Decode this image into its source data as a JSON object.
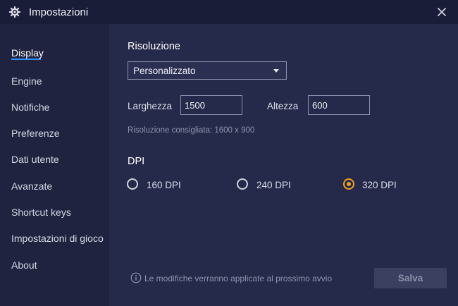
{
  "window": {
    "title": "Impostazioni",
    "app_icon": "gear-icon",
    "close_icon": "close-icon"
  },
  "sidebar": {
    "items": [
      {
        "label": "Display",
        "active": true
      },
      {
        "label": "Engine"
      },
      {
        "label": "Notifiche"
      },
      {
        "label": "Preferenze"
      },
      {
        "label": "Dati utente"
      },
      {
        "label": "Avanzate"
      },
      {
        "label": "Shortcut keys"
      },
      {
        "label": "Impostazioni di gioco"
      },
      {
        "label": "About"
      }
    ]
  },
  "resolution": {
    "title": "Risoluzione",
    "selected": "Personalizzato",
    "width_label": "Larghezza",
    "width_value": "1500",
    "height_label": "Altezza",
    "height_value": "600",
    "hint": "Risoluzione consigliata: 1600 x 900"
  },
  "dpi": {
    "title": "DPI",
    "options": [
      {
        "label": "160 DPI",
        "checked": false
      },
      {
        "label": "240 DPI",
        "checked": false
      },
      {
        "label": "320 DPI",
        "checked": true
      }
    ]
  },
  "footer": {
    "info_icon": "info-icon",
    "info_text": "Le modifiche verranno applicate al prossimo avvio",
    "save_label": "Salva"
  },
  "colors": {
    "background": "#262a4a",
    "sidebar": "#1f2340",
    "titlebar": "#1a1d38",
    "accent_active": "#2f8fff",
    "radio_checked": "#f29d1f"
  }
}
